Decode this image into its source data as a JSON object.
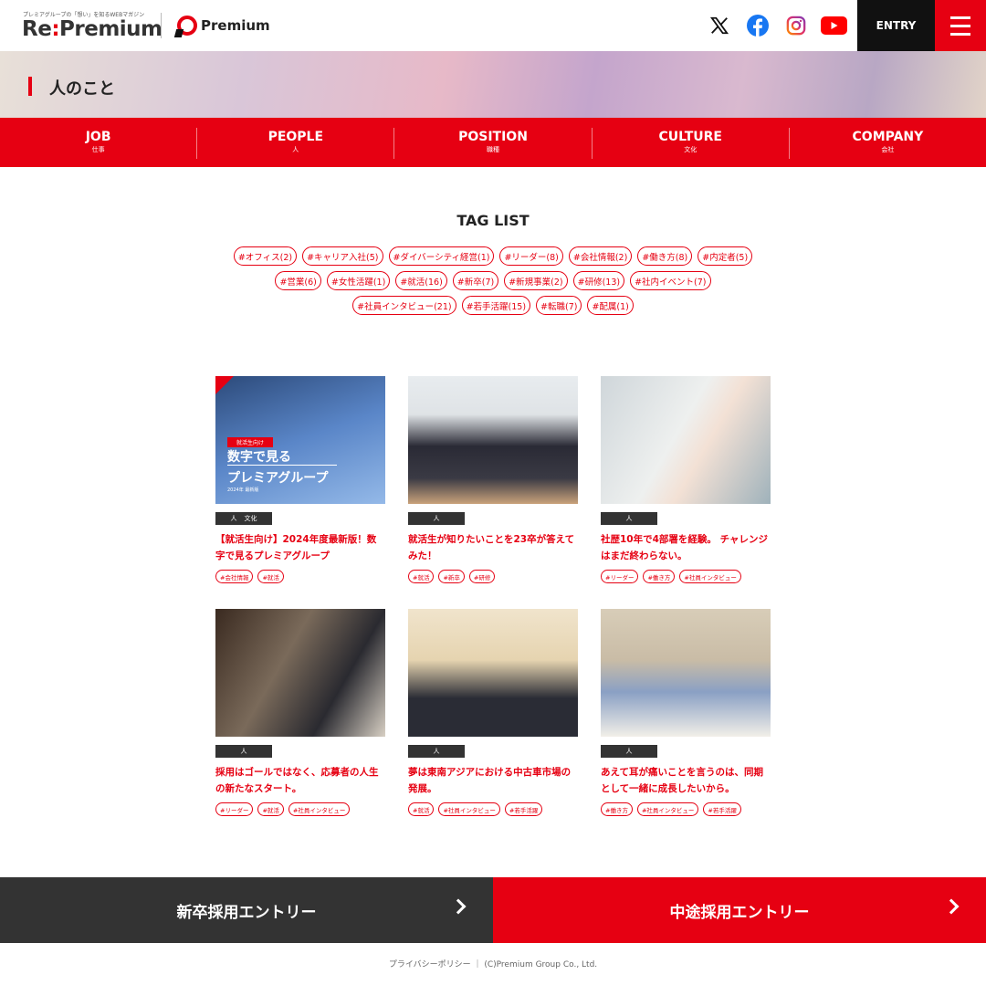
{
  "header": {
    "logo_tagline": "プレミアグループの「想い」を知るWEBマガジン",
    "logo_pre": "Re",
    "logo_colon": ":",
    "logo_post": "Premium",
    "brand": "Premium",
    "entry_label": "ENTRY",
    "social": [
      "x-icon",
      "facebook-icon",
      "instagram-icon",
      "youtube-icon"
    ]
  },
  "hero": {
    "title": "人のこと"
  },
  "nav": [
    {
      "en": "JOB",
      "jp": "仕事"
    },
    {
      "en": "PEOPLE",
      "jp": "人"
    },
    {
      "en": "POSITION",
      "jp": "職種"
    },
    {
      "en": "CULTURE",
      "jp": "文化"
    },
    {
      "en": "COMPANY",
      "jp": "会社"
    }
  ],
  "tag_list": {
    "title": "TAG LIST",
    "tags": [
      "#オフィス(2)",
      "#キャリア入社(5)",
      "#ダイバーシティ経営(1)",
      "#リーダー(8)",
      "#会社情報(2)",
      "#働き方(8)",
      "#内定者(5)",
      "#営業(6)",
      "#女性活躍(1)",
      "#就活(16)",
      "#新卒(7)",
      "#新規事業(2)",
      "#研修(13)",
      "#社内イベント(7)",
      "#社員インタビュー(21)",
      "#若手活躍(15)",
      "#転職(7)",
      "#配属(1)"
    ]
  },
  "articles": [
    {
      "cats": [
        "人",
        "文化"
      ],
      "title": "【就活生向け】2024年度最新版！数字で見るプレミアグループ",
      "tags": [
        "#会社情報",
        "#就活"
      ],
      "img_badge": "就活生向け",
      "img_line1": "数字で見る",
      "img_line2": "プレミアグループ",
      "img_note": "2024年 最新版"
    },
    {
      "cats": [
        "人"
      ],
      "title": "就活生が知りたいことを23卒が答えてみた！",
      "tags": [
        "#就活",
        "#新卒",
        "#研修"
      ]
    },
    {
      "cats": [
        "人"
      ],
      "title": "社歴10年で4部署を経験。 チャレンジはまだ終わらない。",
      "tags": [
        "#リーダー",
        "#働き方",
        "#社員インタビュー"
      ]
    },
    {
      "cats": [
        "人"
      ],
      "title": "採用はゴールではなく、応募者の人生の新たなスタート。",
      "tags": [
        "#リーダー",
        "#就活",
        "#社員インタビュー"
      ]
    },
    {
      "cats": [
        "人"
      ],
      "title": "夢は東南アジアにおける中古車市場の発展。",
      "tags": [
        "#就活",
        "#社員インタビュー",
        "#若手活躍"
      ]
    },
    {
      "cats": [
        "人"
      ],
      "title": "あえて耳が痛いことを言うのは、同期として一緒に成長したいから。",
      "tags": [
        "#働き方",
        "#社員インタビュー",
        "#若手活躍"
      ]
    }
  ],
  "footer": {
    "new_grad": "新卒採用エントリー",
    "mid_career": "中途採用エントリー",
    "copyright": "プライバシーポリシー ｜ (C)Premium Group Co., Ltd."
  },
  "colors": {
    "brand": "#e60012",
    "dark": "#333333"
  }
}
